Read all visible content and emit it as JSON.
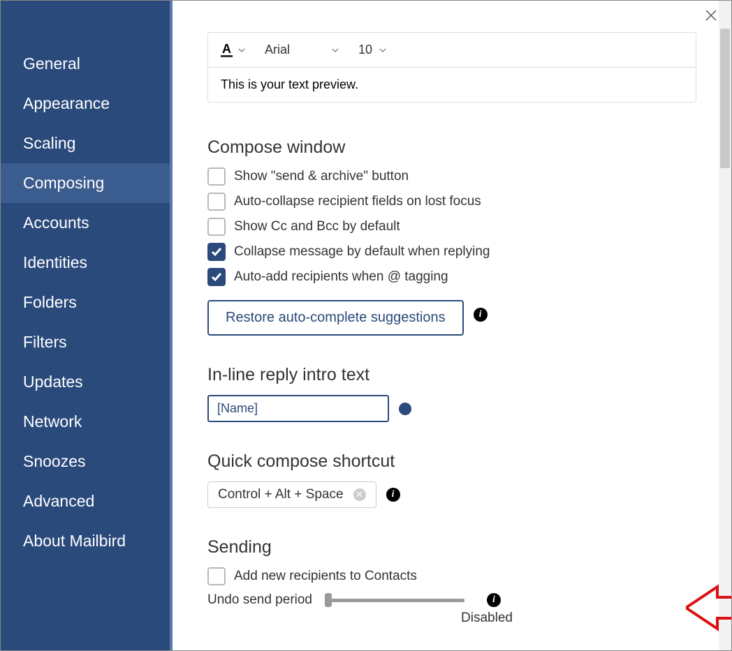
{
  "sidebar": {
    "items": [
      {
        "label": "General"
      },
      {
        "label": "Appearance"
      },
      {
        "label": "Scaling"
      },
      {
        "label": "Composing"
      },
      {
        "label": "Accounts"
      },
      {
        "label": "Identities"
      },
      {
        "label": "Folders"
      },
      {
        "label": "Filters"
      },
      {
        "label": "Updates"
      },
      {
        "label": "Network"
      },
      {
        "label": "Snoozes"
      },
      {
        "label": "Advanced"
      },
      {
        "label": "About Mailbird"
      }
    ]
  },
  "font_bar": {
    "font_name": "Arial",
    "font_size": "10"
  },
  "preview_text": "This is your text preview.",
  "compose_window": {
    "title": "Compose window",
    "options": [
      {
        "label": "Show \"send & archive\" button",
        "checked": false
      },
      {
        "label": "Auto-collapse recipient fields on lost focus",
        "checked": false
      },
      {
        "label": "Show Cc and Bcc by default",
        "checked": false
      },
      {
        "label": "Collapse message by default when replying",
        "checked": true
      },
      {
        "label": "Auto-add recipients when @ tagging",
        "checked": true
      }
    ],
    "restore_button": "Restore auto-complete suggestions"
  },
  "inline_reply": {
    "title": "In-line reply intro text",
    "value": "[Name]",
    "color": "#2a4a7b"
  },
  "quick_compose": {
    "title": "Quick compose shortcut",
    "value": "Control + Alt + Space"
  },
  "sending": {
    "title": "Sending",
    "add_recipients_label": "Add new recipients to Contacts",
    "undo_label": "Undo send period",
    "undo_value": "Disabled"
  }
}
